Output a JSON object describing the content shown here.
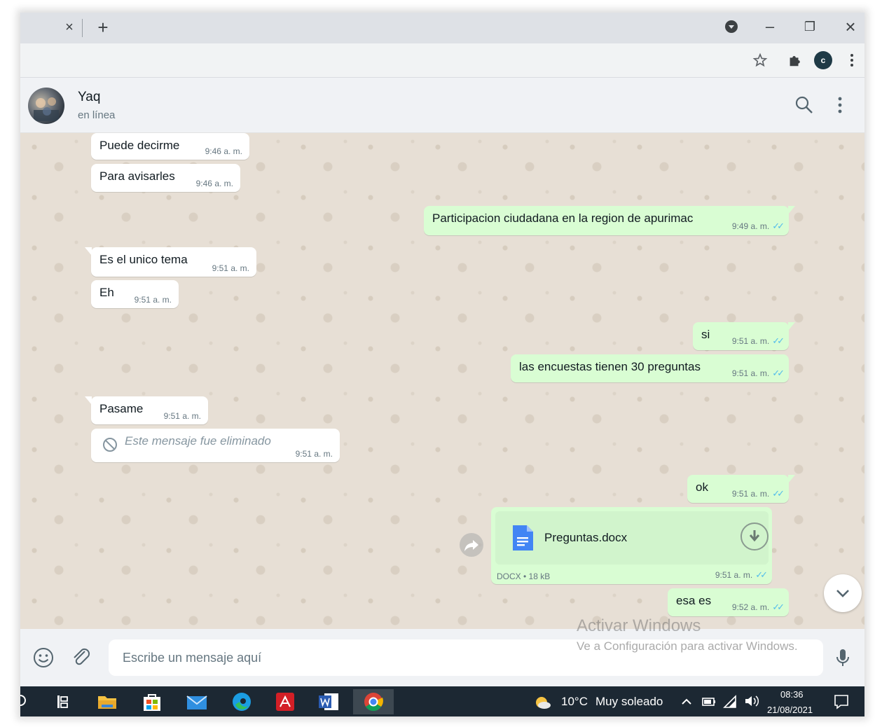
{
  "browser": {
    "tab_close": "×",
    "new_tab": "+",
    "window_minimize": "–",
    "window_restore": "❐",
    "window_close": "×",
    "profile_initial": "c"
  },
  "contact": {
    "name": "Yaq",
    "status": "en línea"
  },
  "messages": [
    {
      "dir": "in",
      "text": "Puede decirme",
      "time": "9:46 a. m."
    },
    {
      "dir": "in",
      "text": "Para avisarles",
      "time": "9:46 a. m."
    },
    {
      "dir": "out",
      "text": "Participacion ciudadana en la region de apurimac",
      "time": "9:49 a. m."
    },
    {
      "dir": "in",
      "text": "Es el unico tema",
      "time": "9:51 a. m."
    },
    {
      "dir": "in",
      "text": "Eh",
      "time": "9:51 a. m."
    },
    {
      "dir": "out",
      "text": "si",
      "time": "9:51 a. m."
    },
    {
      "dir": "out",
      "text": "las encuestas tienen 30 preguntas",
      "time": "9:51 a. m."
    },
    {
      "dir": "in",
      "text": "Pasame",
      "time": "9:51 a. m."
    },
    {
      "dir": "in",
      "text": "Este mensaje fue eliminado",
      "time": "9:51 a. m.",
      "deleted": true
    },
    {
      "dir": "out",
      "text": "ok",
      "time": "9:51 a. m."
    },
    {
      "dir": "out",
      "document": {
        "filename": "Preguntas.docx",
        "meta": "DOCX • 18 kB"
      },
      "time": "9:51 a. m."
    },
    {
      "dir": "out",
      "text": "esa es",
      "time": "9:52 a. m."
    }
  ],
  "read_ticks": "✓✓",
  "composer": {
    "placeholder": "Escribe un mensaje aquí"
  },
  "watermark": {
    "title": "Activar Windows",
    "subtitle": "Ve a Configuración para activar Windows."
  },
  "taskbar": {
    "weather_temp": "10°C",
    "weather_desc": "Muy soleado",
    "time": "08:36",
    "date": "21/08/2021"
  },
  "colors": {
    "outgoing_bubble": "#d9fdd3",
    "incoming_bubble": "#ffffff",
    "chat_background": "#e7dfd5",
    "read_ticks": "#53bdeb"
  }
}
